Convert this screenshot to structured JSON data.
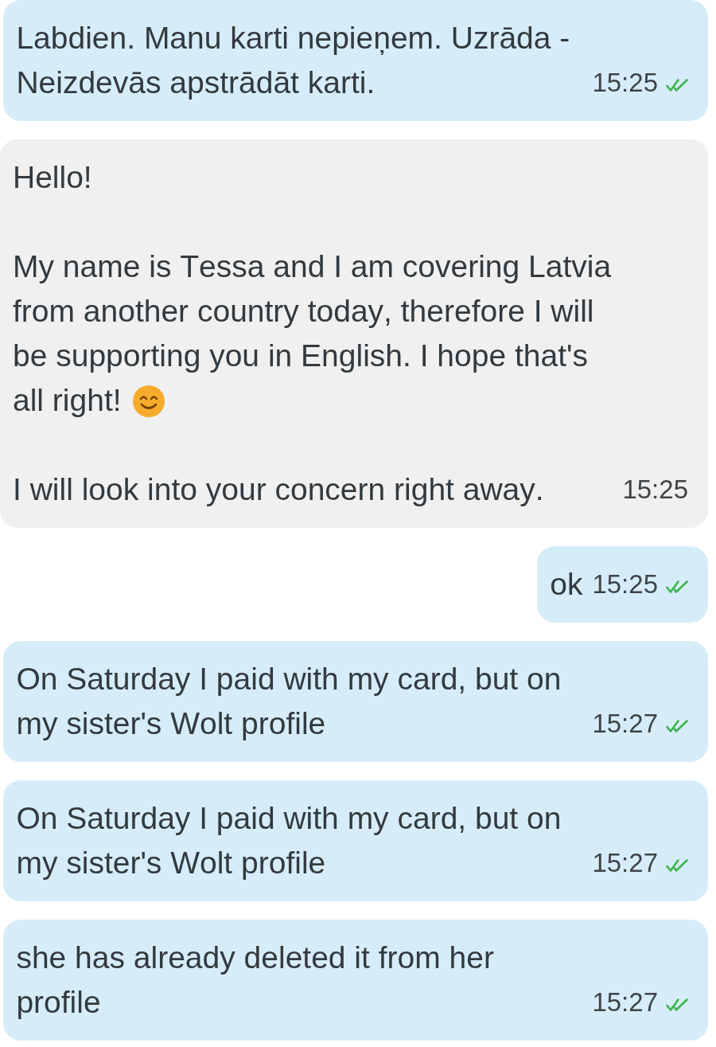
{
  "messages": [
    {
      "kind": "sent",
      "paragraphs": [
        {
          "text": "Labdien. Manu karti nepieņem. Uzrāda - Neizdevās apstrādāt karti."
        }
      ],
      "time": "15:25",
      "read": true
    },
    {
      "kind": "received",
      "paragraphs": [
        {
          "text": "Hello!"
        },
        {
          "text": "My name is Tessa and I am covering Latvia from another country today, therefore I will be supporting you in English. I hope that's all right!",
          "emoji": true
        },
        {
          "text": "I will look into your concern right away."
        }
      ],
      "time": "15:25"
    },
    {
      "kind": "sent",
      "paragraphs": [
        {
          "text": "ok"
        }
      ],
      "time": "15:25",
      "read": true
    },
    {
      "kind": "sent",
      "paragraphs": [
        {
          "text": "On Saturday I paid with my card, but on my sister's Wolt profile"
        }
      ],
      "time": "15:27",
      "read": true
    },
    {
      "kind": "sent",
      "paragraphs": [
        {
          "text": "On Saturday I paid with my card, but on my sister's Wolt profile"
        }
      ],
      "time": "15:27",
      "read": true
    },
    {
      "kind": "sent",
      "paragraphs": [
        {
          "text": "she has already deleted it from her profile"
        }
      ],
      "time": "15:27",
      "read": true
    }
  ]
}
